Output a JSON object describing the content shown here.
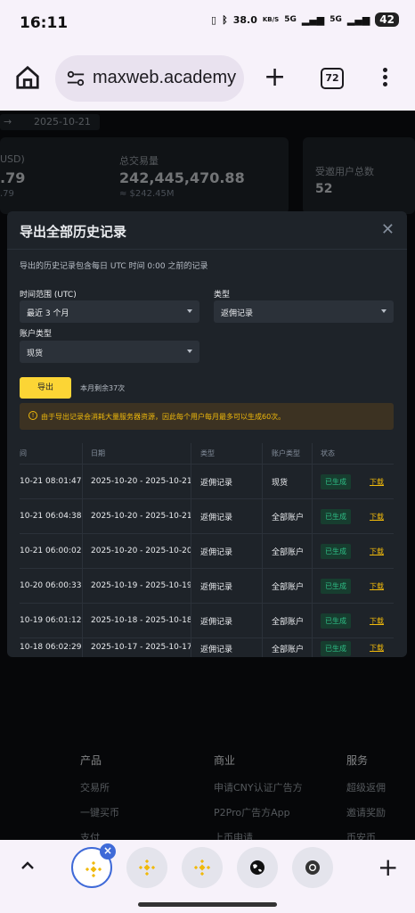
{
  "status_bar": {
    "time": "16:11",
    "speed": "38.0",
    "speed_unit": "KB/S",
    "network1": "5G",
    "network2": "5G",
    "battery": "42"
  },
  "browser": {
    "url": "maxweb.academy",
    "tab_count": "72"
  },
  "background": {
    "date_end": "2025-10-21",
    "card1_label": "USD)",
    "card1_value": ".79",
    "card1_sub": ".79",
    "card2_label": "总交易量",
    "card2_value": "242,445,470.88",
    "card2_sub": "≈ $242.45M",
    "card3_label": "受邀用户总数",
    "card3_value": "52"
  },
  "modal": {
    "title": "导出全部历史记录",
    "description": "导出的历史记录包含每日 UTC 时间 0:00 之前的记录",
    "time_range_label": "时间范围 (UTC)",
    "time_range_value": "最近 3 个月",
    "type_label": "类型",
    "type_value": "返佣记录",
    "account_type_label": "账户类型",
    "account_type_value": "现货",
    "export_button": "导出",
    "remaining_text": "本月剩余37次",
    "notice": "由于导出记录会消耗大量服务器资源，因此每个用户每月最多可以生成60次。",
    "table": {
      "headers": [
        "间",
        "日期",
        "类型",
        "账户类型",
        "状态"
      ],
      "rows": [
        {
          "time": "10-21 08:01:47",
          "date": "2025-10-20 - 2025-10-21",
          "type": "返佣记录",
          "account": "现货",
          "status": "已生成",
          "action": "下载"
        },
        {
          "time": "10-21 06:04:38",
          "date": "2025-10-20 - 2025-10-21",
          "type": "返佣记录",
          "account": "全部账户",
          "status": "已生成",
          "action": "下载"
        },
        {
          "time": "10-21 06:00:02",
          "date": "2025-10-20 - 2025-10-20",
          "type": "返佣记录",
          "account": "全部账户",
          "status": "已生成",
          "action": "下载"
        },
        {
          "time": "10-20 06:00:33",
          "date": "2025-10-19 - 2025-10-19",
          "type": "返佣记录",
          "account": "全部账户",
          "status": "已生成",
          "action": "下载"
        },
        {
          "time": "10-19 06:01:12",
          "date": "2025-10-18 - 2025-10-18",
          "type": "返佣记录",
          "account": "全部账户",
          "status": "已生成",
          "action": "下载"
        },
        {
          "time": "10-18 06:02:29",
          "date": "2025-10-17 - 2025-10-17",
          "type": "返佣记录",
          "account": "全部账户",
          "status": "已生成",
          "action": "下载"
        }
      ]
    }
  },
  "footer": {
    "col1": {
      "heading": "产品",
      "items": [
        "交易所",
        "一键买币",
        "支付"
      ]
    },
    "col2": {
      "heading": "商业",
      "items": [
        "申请CNY认证广告方",
        "P2Pro广告方App",
        "上币申请"
      ]
    },
    "col3": {
      "heading": "服务",
      "items": [
        "超级返佣",
        "邀请奖励",
        "币安币"
      ]
    }
  },
  "colors": {
    "accent": "#fcd535",
    "success": "#2ebd85",
    "modal_bg": "#1e2329"
  }
}
